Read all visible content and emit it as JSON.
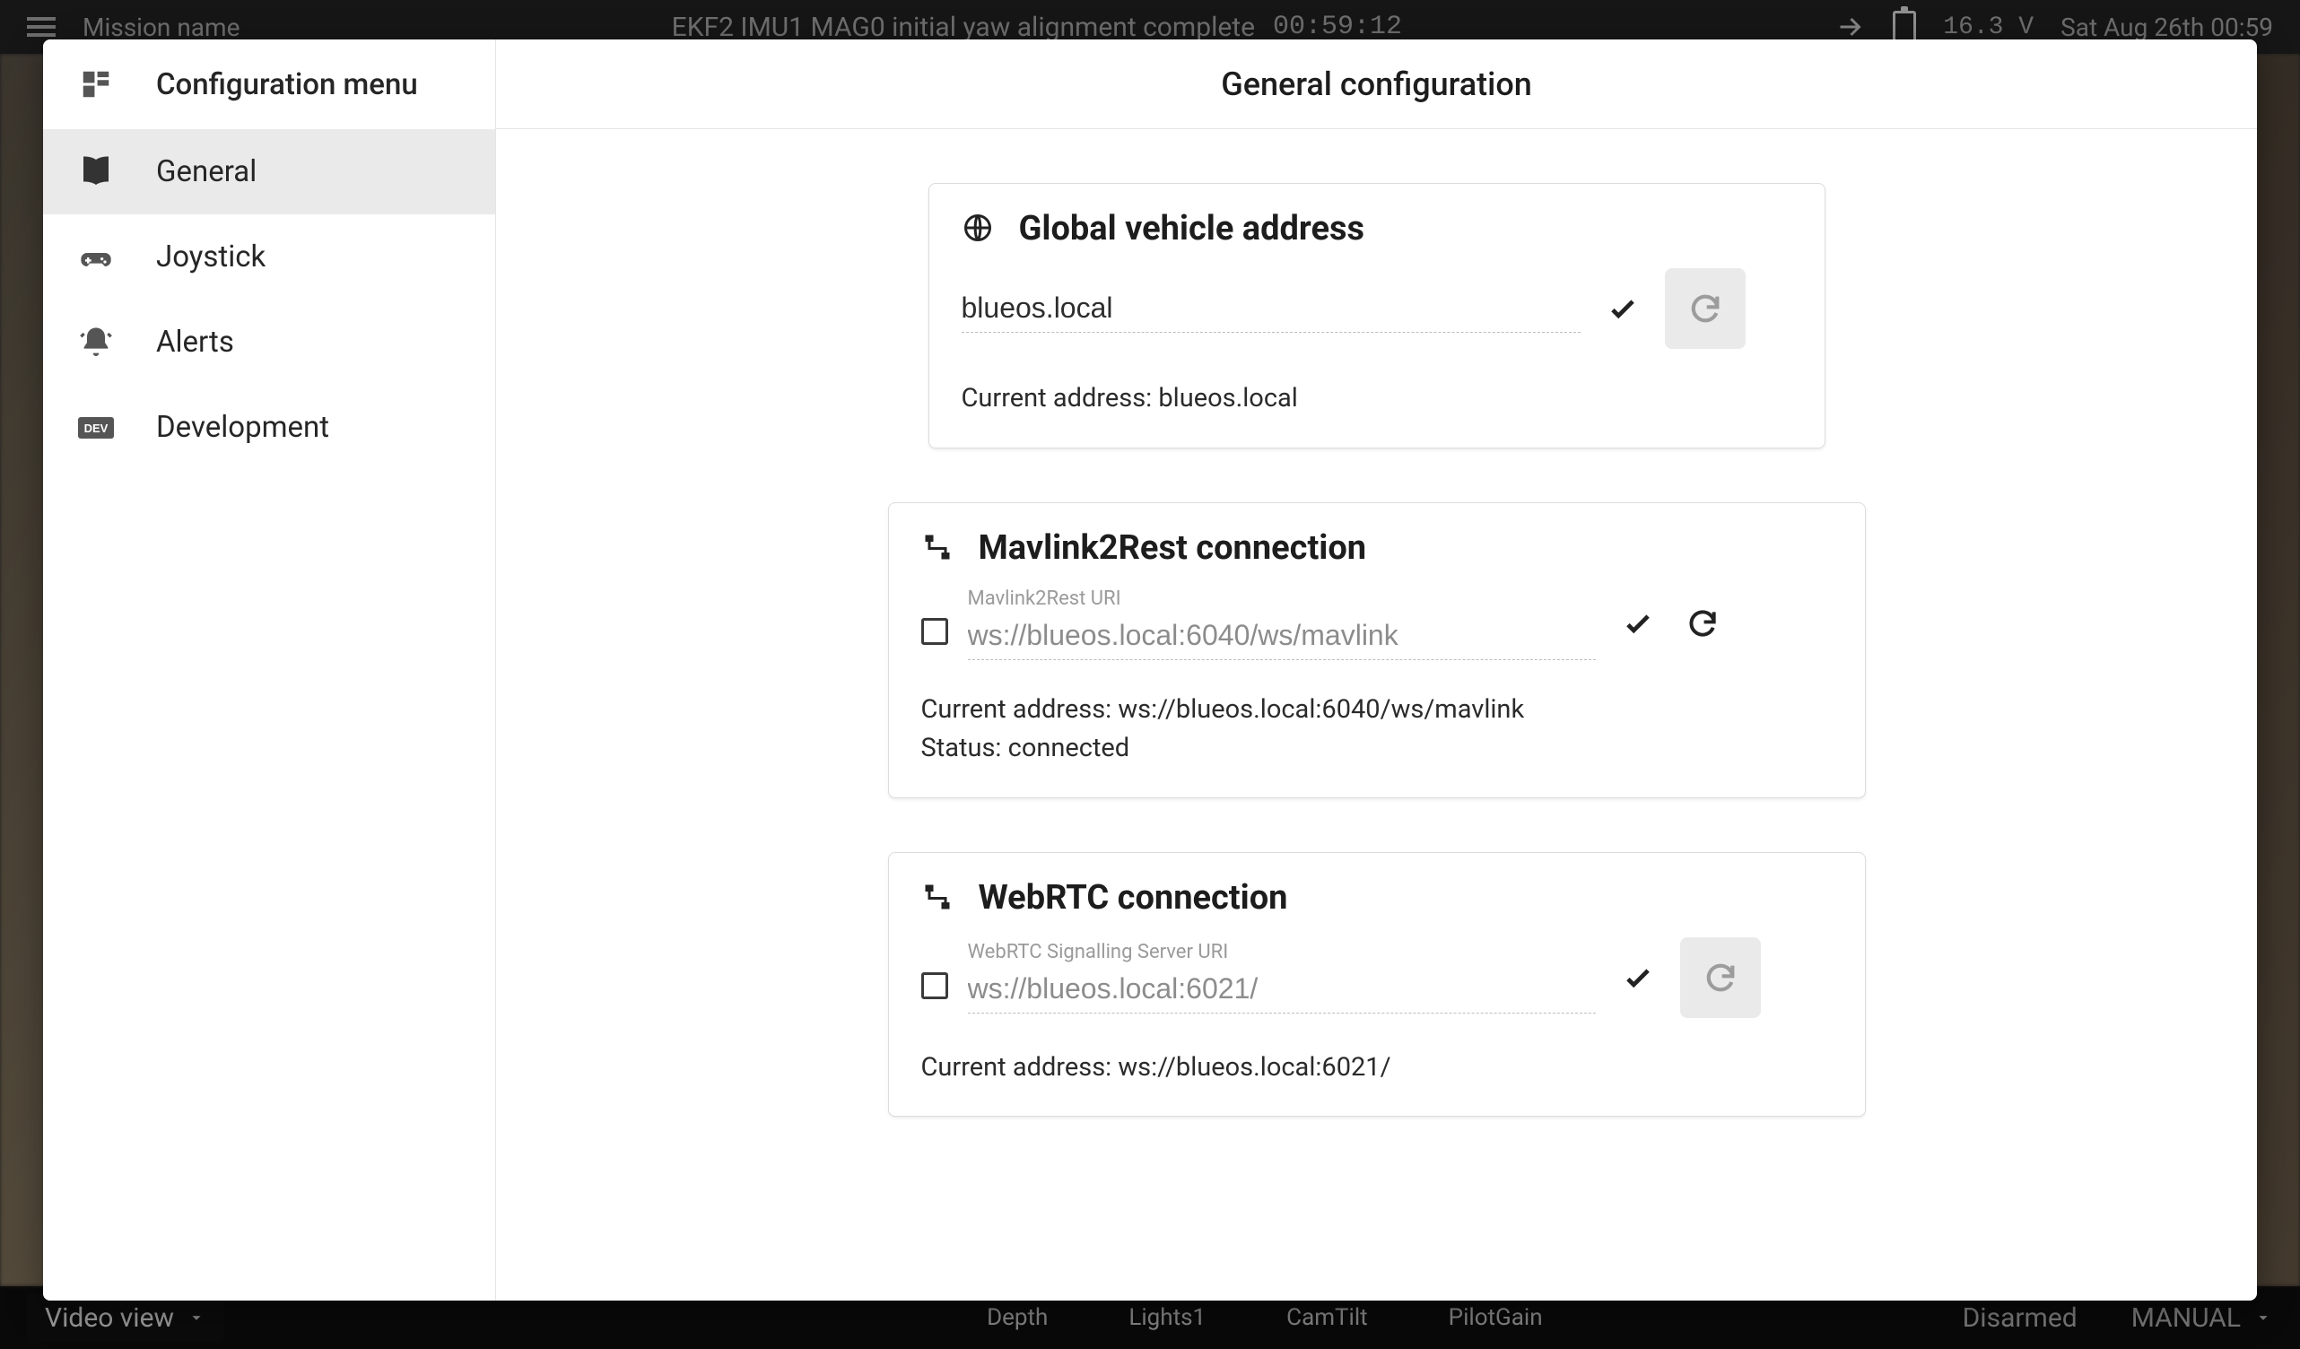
{
  "bg_topbar": {
    "mission_name": "Mission name",
    "center_text": "EKF2 IMU1 MAG0 initial yaw alignment complete",
    "timer": "00:59:12",
    "voltage": "16.3 V",
    "datetime": "Sat Aug 26th 00:59"
  },
  "bg_bottombar": {
    "video_btn": "Video view",
    "items": [
      "Depth",
      "Lights1",
      "CamTilt",
      "PilotGain"
    ],
    "disarmed": "Disarmed",
    "mode": "MANUAL"
  },
  "sidebar": {
    "header": "Configuration menu",
    "items": [
      {
        "label": "General",
        "icon": "book"
      },
      {
        "label": "Joystick",
        "icon": "gamepad"
      },
      {
        "label": "Alerts",
        "icon": "bell"
      },
      {
        "label": "Development",
        "icon": "dev"
      }
    ]
  },
  "main": {
    "title": "General configuration",
    "cards": [
      {
        "title": "Global vehicle address",
        "input_value": "blueos.local",
        "status_lines": [
          "Current address: blueos.local"
        ]
      },
      {
        "title": "Mavlink2Rest connection",
        "input_label": "Mavlink2Rest URI",
        "input_placeholder": "ws://blueos.local:6040/ws/mavlink",
        "status_lines": [
          "Current address: ws://blueos.local:6040/ws/mavlink",
          "Status: connected"
        ]
      },
      {
        "title": "WebRTC connection",
        "input_label": "WebRTC Signalling Server URI",
        "input_placeholder": "ws://blueos.local:6021/",
        "status_lines": [
          "Current address: ws://blueos.local:6021/"
        ]
      }
    ]
  }
}
